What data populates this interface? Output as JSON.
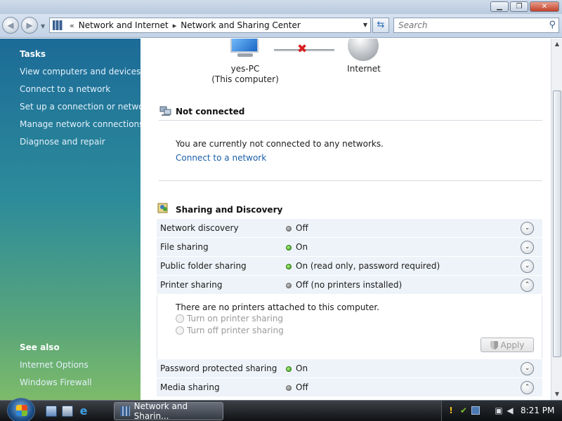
{
  "window": {
    "minimize_glyph": "▁",
    "maximize_glyph": "❐",
    "close_glyph": "✕"
  },
  "address_bar": {
    "back_glyph": "◀",
    "forward_glyph": "▶",
    "overflow_glyph": "«",
    "crumb_separator": "▸",
    "breadcrumbs": [
      "Network and Internet",
      "Network and Sharing Center"
    ],
    "refresh_glyph": "⇆",
    "search_placeholder": "Search",
    "search_glyph": "⚲"
  },
  "left_pane": {
    "tasks_heading": "Tasks",
    "tasks": [
      "View computers and devices",
      "Connect to a network",
      "Set up a connection or network",
      "Manage network connections",
      "Diagnose and repair"
    ],
    "see_also_heading": "See also",
    "see_also": [
      "Internet Options",
      "Windows Firewall"
    ]
  },
  "network_map": {
    "computer_name": "yes-PC",
    "computer_sub": "(This computer)",
    "disconnected_glyph": "✖",
    "internet_label": "Internet"
  },
  "connection": {
    "title": "Not connected",
    "message": "You are currently not connected to any networks.",
    "link": "Connect to a network"
  },
  "sharing": {
    "title": "Sharing and Discovery",
    "rows": [
      {
        "label": "Network discovery",
        "status": "Off",
        "state": "off",
        "expander": "⌄"
      },
      {
        "label": "File sharing",
        "status": "On",
        "state": "on",
        "expander": "⌄"
      },
      {
        "label": "Public folder sharing",
        "status": "On (read only, password required)",
        "state": "on",
        "expander": "⌄"
      },
      {
        "label": "Printer sharing",
        "status": "Off (no printers installed)",
        "state": "off",
        "expander": "⌃"
      },
      {
        "label": "Password protected sharing",
        "status": "On",
        "state": "on",
        "expander": "⌄"
      },
      {
        "label": "Media sharing",
        "status": "Off",
        "state": "off",
        "expander": "⌃"
      }
    ],
    "printer_panel": {
      "message": "There are no printers attached to this computer.",
      "option_on": "Turn on printer sharing",
      "option_off": "Turn off printer sharing",
      "apply": "Apply"
    }
  },
  "taskbar": {
    "task_label": "Network and Sharin...",
    "clock": "8:21 PM",
    "ie_glyph": "e"
  },
  "colors": {
    "link": "#1b5fa8",
    "status_on": "#2c9b12",
    "disconnected": "#d81e1e"
  }
}
